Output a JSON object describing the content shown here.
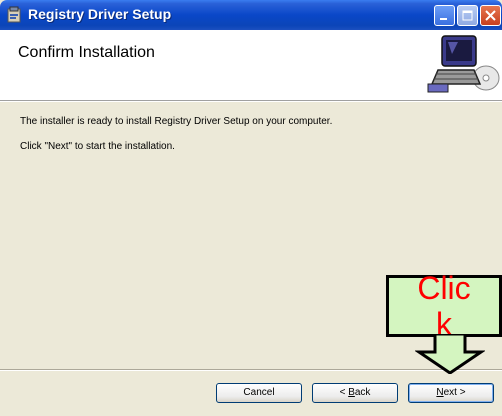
{
  "window": {
    "title": "Registry Driver Setup",
    "controls": [
      "minimize-icon",
      "maximize-icon",
      "close-icon"
    ]
  },
  "header": {
    "title": "Confirm Installation",
    "icon": "computer-cd-icon"
  },
  "content": {
    "line1": "The installer is ready to install Registry Driver Setup on your computer.",
    "line2": "Click \"Next\" to start the installation."
  },
  "buttons": {
    "cancel": "Cancel",
    "back_mnemonic": "B",
    "back_rest": "ack",
    "back_prefix": "< ",
    "next_mnemonic": "N",
    "next_rest": "ext",
    "next_suffix": " >"
  },
  "annotation": {
    "text_line1": "Clic",
    "text_line2": "k",
    "fill_color": "#d4f5c0",
    "text_color": "#ff0000"
  },
  "colors": {
    "titlebar": "#0a47c8",
    "dialog_bg": "#ece9d8",
    "header_bg": "#ffffff"
  }
}
